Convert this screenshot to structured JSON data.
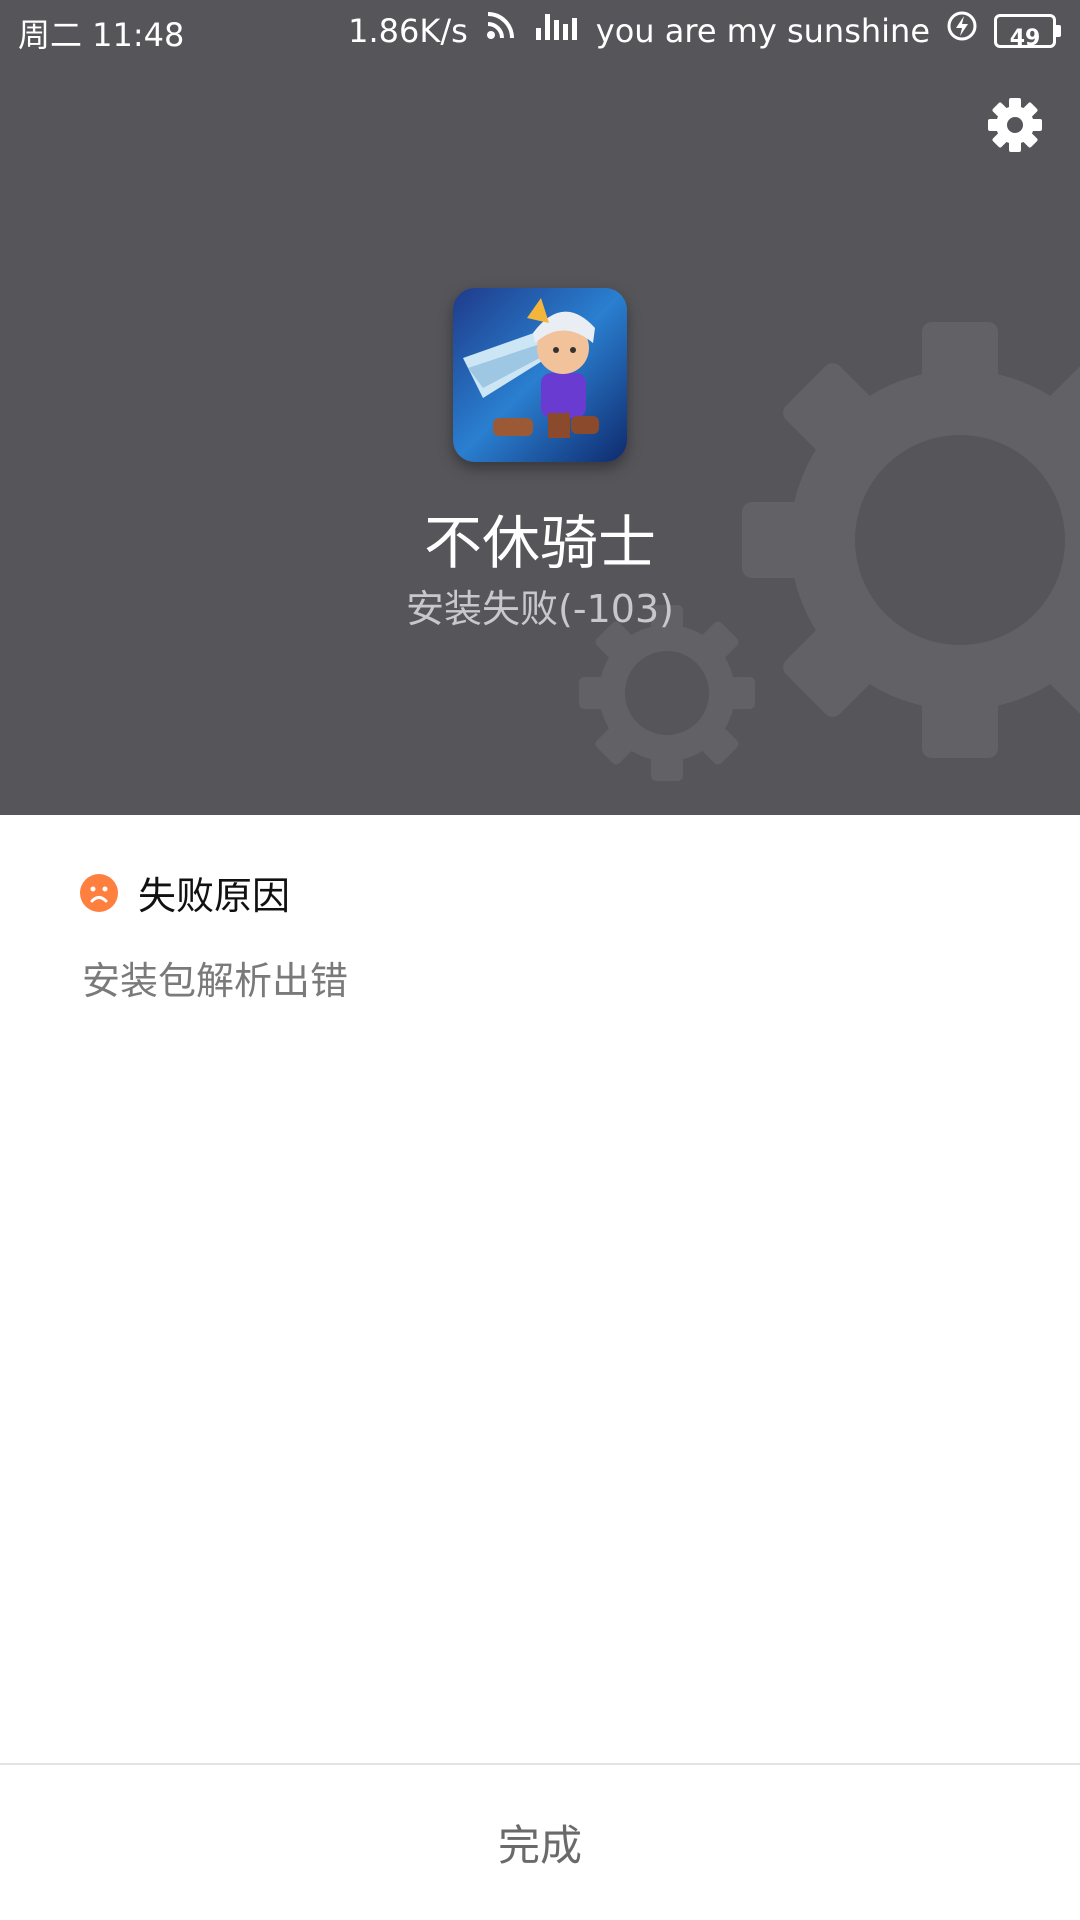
{
  "status_bar": {
    "time": "周二 11:48",
    "net_speed": "1.86K/s",
    "carrier": "you are my sunshine",
    "battery": "49"
  },
  "app": {
    "name": "不休骑士",
    "status": "安装失败(-103)"
  },
  "failure": {
    "title": "失败原因",
    "message": "安装包解析出错"
  },
  "footer": {
    "done_label": "完成"
  },
  "colors": {
    "header_bg": "#55555a",
    "gear_decor": "#626266",
    "sad_icon": "#ff7f3f"
  }
}
